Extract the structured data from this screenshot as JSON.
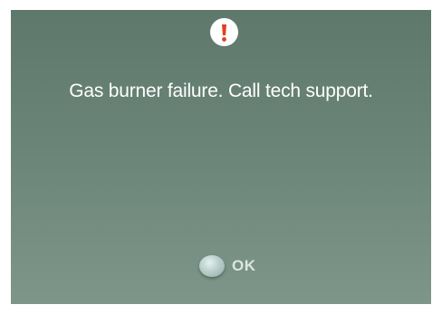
{
  "dialog": {
    "icon": "alert-icon",
    "message": "Gas burner failure. Call tech support.",
    "ok_label": "OK"
  },
  "colors": {
    "background_top": "#5e786c",
    "background_bottom": "#7e9689",
    "alert_badge": "#ffffff",
    "alert_mark": "#e0401f",
    "text": "#ffffff"
  }
}
